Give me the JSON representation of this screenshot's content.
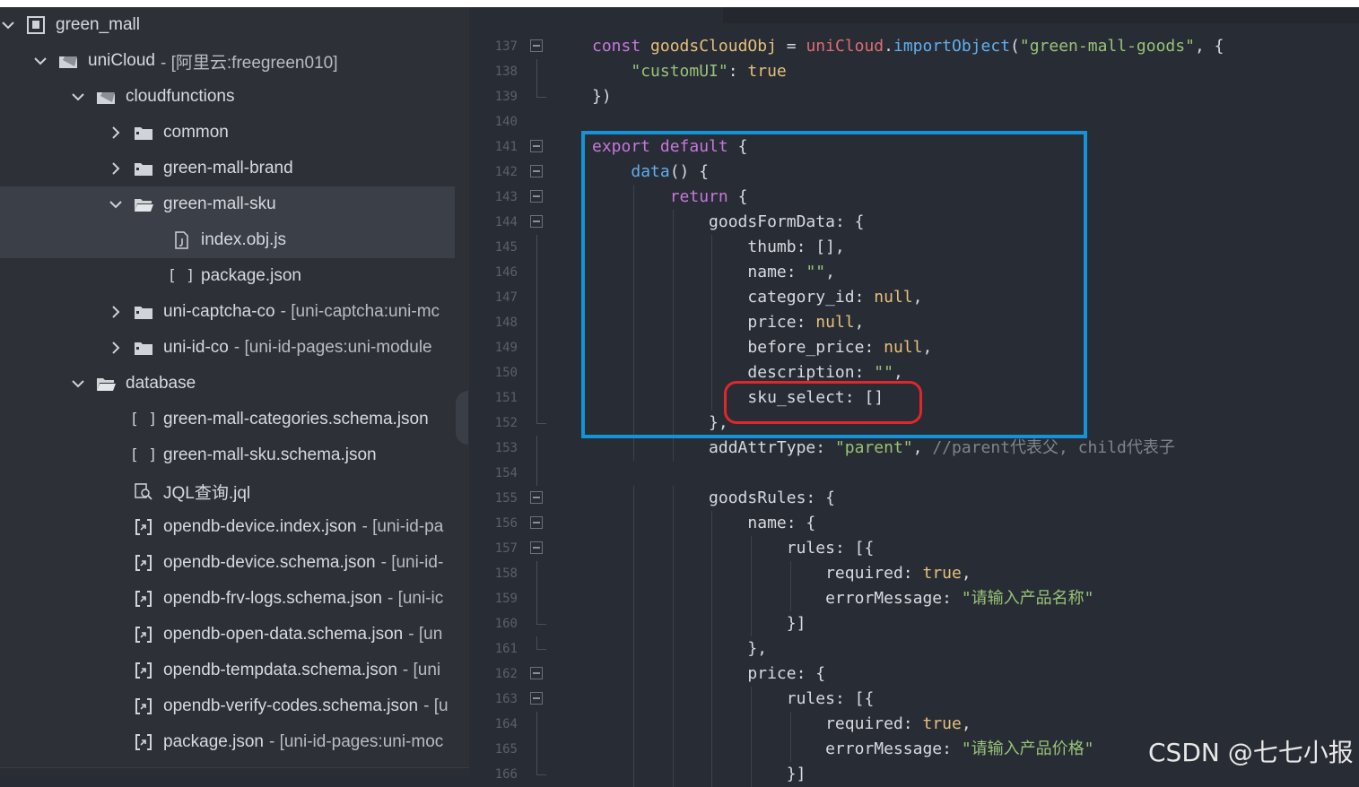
{
  "explorer": {
    "items": [
      {
        "name": "green_mall",
        "meta": "",
        "icon": "project-icon",
        "arrow": "expanded",
        "indent": 0
      },
      {
        "name": "uniCloud",
        "meta": "- [阿里云:freegreen010]",
        "icon": "cloud-folder-icon",
        "arrow": "expanded",
        "indent": 1
      },
      {
        "name": "cloudfunctions",
        "meta": "",
        "icon": "cloud-folder-icon",
        "arrow": "expanded",
        "indent": 2
      },
      {
        "name": "common",
        "meta": "",
        "icon": "folder-icon",
        "arrow": "collapsed",
        "indent": 3
      },
      {
        "name": "green-mall-brand",
        "meta": "",
        "icon": "folder-icon",
        "arrow": "collapsed",
        "indent": 3
      },
      {
        "name": "green-mall-sku",
        "meta": "",
        "icon": "folder-open-icon",
        "arrow": "expanded",
        "indent": 3,
        "selected": true,
        "right_icon": "folder-icon"
      },
      {
        "name": "index.obj.js",
        "meta": "",
        "icon": "js-file-icon",
        "arrow": "none",
        "indent": 4,
        "selected": true
      },
      {
        "name": "package.json",
        "meta": "",
        "icon": "json-file-icon",
        "arrow": "none",
        "indent": 4
      },
      {
        "name": "uni-captcha-co",
        "meta": "- [uni-captcha:uni-mc",
        "icon": "folder-icon",
        "arrow": "collapsed",
        "indent": 3
      },
      {
        "name": "uni-id-co",
        "meta": "- [uni-id-pages:uni-module",
        "icon": "folder-icon",
        "arrow": "collapsed",
        "indent": 3
      },
      {
        "name": "database",
        "meta": "",
        "icon": "folder-open-icon",
        "arrow": "expanded",
        "indent": 2
      },
      {
        "name": "green-mall-categories.schema.json",
        "meta": "",
        "icon": "json-file-icon",
        "arrow": "none",
        "indent": 3
      },
      {
        "name": "green-mall-sku.schema.json",
        "meta": "",
        "icon": "json-file-icon",
        "arrow": "none",
        "indent": 3
      },
      {
        "name": "JQL查询.jql",
        "meta": "",
        "icon": "jql-file-icon",
        "arrow": "none",
        "indent": 3
      },
      {
        "name": "opendb-device.index.json",
        "meta": "- [uni-id-pa",
        "icon": "linked-json-icon",
        "arrow": "none",
        "indent": 3
      },
      {
        "name": "opendb-device.schema.json",
        "meta": "- [uni-id-",
        "icon": "linked-json-icon",
        "arrow": "none",
        "indent": 3
      },
      {
        "name": "opendb-frv-logs.schema.json",
        "meta": "- [uni-ic",
        "icon": "linked-json-icon",
        "arrow": "none",
        "indent": 3
      },
      {
        "name": "opendb-open-data.schema.json",
        "meta": "- [un",
        "icon": "linked-json-icon",
        "arrow": "none",
        "indent": 3
      },
      {
        "name": "opendb-tempdata.schema.json",
        "meta": "- [uni",
        "icon": "linked-json-icon",
        "arrow": "none",
        "indent": 3
      },
      {
        "name": "opendb-verify-codes.schema.json",
        "meta": "- [u",
        "icon": "linked-json-icon",
        "arrow": "none",
        "indent": 3
      },
      {
        "name": "package.json",
        "meta": "- [uni-id-pages:uni-moc",
        "icon": "linked-json-icon",
        "arrow": "none",
        "indent": 3
      }
    ]
  },
  "editor": {
    "lines": [
      {
        "n": "137",
        "fold": "open",
        "tokens": [
          [
            "kw",
            "const "
          ],
          [
            "var",
            "goodsCloudObj"
          ],
          [
            "plain",
            " = "
          ],
          [
            "cls",
            "uniCloud"
          ],
          [
            "plain",
            "."
          ],
          [
            "fn",
            "importObject"
          ],
          [
            "plain",
            "("
          ],
          [
            "str",
            "\"green-mall-goods\""
          ],
          [
            "plain",
            ", {"
          ]
        ]
      },
      {
        "n": "138",
        "fold": "line",
        "tokens": [
          [
            "plain",
            "    "
          ],
          [
            "str",
            "\"customUI\""
          ],
          [
            "plain",
            ": "
          ],
          [
            "bool",
            "true"
          ]
        ]
      },
      {
        "n": "139",
        "fold": "end",
        "tokens": [
          [
            "plain",
            "})"
          ]
        ]
      },
      {
        "n": "140",
        "fold": "",
        "tokens": []
      },
      {
        "n": "141",
        "fold": "open",
        "tokens": [
          [
            "kw",
            "export default "
          ],
          [
            "plain",
            "{"
          ]
        ]
      },
      {
        "n": "142",
        "fold": "open",
        "tokens": [
          [
            "plain",
            "    "
          ],
          [
            "fn",
            "data"
          ],
          [
            "plain",
            "() {"
          ]
        ]
      },
      {
        "n": "143",
        "fold": "open",
        "tokens": [
          [
            "plain",
            "        "
          ],
          [
            "kw",
            "return "
          ],
          [
            "plain",
            "{"
          ]
        ]
      },
      {
        "n": "144",
        "fold": "open",
        "tokens": [
          [
            "plain",
            "            "
          ],
          [
            "prop",
            "goodsFormData"
          ],
          [
            "plain",
            ": {"
          ]
        ]
      },
      {
        "n": "145",
        "fold": "line",
        "tokens": [
          [
            "plain",
            "                "
          ],
          [
            "prop",
            "thumb"
          ],
          [
            "plain",
            ": [],"
          ]
        ]
      },
      {
        "n": "146",
        "fold": "line",
        "tokens": [
          [
            "plain",
            "                "
          ],
          [
            "prop",
            "name"
          ],
          [
            "plain",
            ": "
          ],
          [
            "str",
            "\"\""
          ],
          [
            "plain",
            ","
          ]
        ]
      },
      {
        "n": "147",
        "fold": "line",
        "tokens": [
          [
            "plain",
            "                "
          ],
          [
            "prop",
            "category_id"
          ],
          [
            "plain",
            ": "
          ],
          [
            "bool",
            "null"
          ],
          [
            "plain",
            ","
          ]
        ]
      },
      {
        "n": "148",
        "fold": "line",
        "tokens": [
          [
            "plain",
            "                "
          ],
          [
            "prop",
            "price"
          ],
          [
            "plain",
            ": "
          ],
          [
            "bool",
            "null"
          ],
          [
            "plain",
            ","
          ]
        ]
      },
      {
        "n": "149",
        "fold": "line",
        "tokens": [
          [
            "plain",
            "                "
          ],
          [
            "prop",
            "before_price"
          ],
          [
            "plain",
            ": "
          ],
          [
            "bool",
            "null"
          ],
          [
            "plain",
            ","
          ]
        ]
      },
      {
        "n": "150",
        "fold": "line",
        "tokens": [
          [
            "plain",
            "                "
          ],
          [
            "prop",
            "description"
          ],
          [
            "plain",
            ": "
          ],
          [
            "str",
            "\"\""
          ],
          [
            "plain",
            ","
          ]
        ]
      },
      {
        "n": "151",
        "fold": "line",
        "tokens": [
          [
            "plain",
            "                "
          ],
          [
            "prop",
            "sku_select"
          ],
          [
            "plain",
            ": []"
          ]
        ]
      },
      {
        "n": "152",
        "fold": "end",
        "tokens": [
          [
            "plain",
            "            },"
          ]
        ]
      },
      {
        "n": "153",
        "fold": "line",
        "tokens": [
          [
            "plain",
            "            "
          ],
          [
            "prop",
            "addAttrType"
          ],
          [
            "plain",
            ": "
          ],
          [
            "str",
            "\"parent\""
          ],
          [
            "plain",
            ", "
          ],
          [
            "cmt",
            "//parent代表父, child代表子"
          ]
        ]
      },
      {
        "n": "154",
        "fold": "line",
        "tokens": []
      },
      {
        "n": "155",
        "fold": "open",
        "tokens": [
          [
            "plain",
            "            "
          ],
          [
            "prop",
            "goodsRules"
          ],
          [
            "plain",
            ": {"
          ]
        ]
      },
      {
        "n": "156",
        "fold": "open",
        "tokens": [
          [
            "plain",
            "                "
          ],
          [
            "prop",
            "name"
          ],
          [
            "plain",
            ": {"
          ]
        ]
      },
      {
        "n": "157",
        "fold": "open",
        "tokens": [
          [
            "plain",
            "                    "
          ],
          [
            "prop",
            "rules"
          ],
          [
            "plain",
            ": [{"
          ]
        ]
      },
      {
        "n": "158",
        "fold": "line",
        "tokens": [
          [
            "plain",
            "                        "
          ],
          [
            "prop",
            "required"
          ],
          [
            "plain",
            ": "
          ],
          [
            "bool",
            "true"
          ],
          [
            "plain",
            ","
          ]
        ]
      },
      {
        "n": "159",
        "fold": "line",
        "tokens": [
          [
            "plain",
            "                        "
          ],
          [
            "prop",
            "errorMessage"
          ],
          [
            "plain",
            ": "
          ],
          [
            "str",
            "\"请输入产品名称\""
          ]
        ]
      },
      {
        "n": "160",
        "fold": "end",
        "tokens": [
          [
            "plain",
            "                    }]"
          ]
        ]
      },
      {
        "n": "161",
        "fold": "end",
        "tokens": [
          [
            "plain",
            "                },"
          ]
        ]
      },
      {
        "n": "162",
        "fold": "open",
        "tokens": [
          [
            "plain",
            "                "
          ],
          [
            "prop",
            "price"
          ],
          [
            "plain",
            ": {"
          ]
        ]
      },
      {
        "n": "163",
        "fold": "open",
        "tokens": [
          [
            "plain",
            "                    "
          ],
          [
            "prop",
            "rules"
          ],
          [
            "plain",
            ": [{"
          ]
        ]
      },
      {
        "n": "164",
        "fold": "line",
        "tokens": [
          [
            "plain",
            "                        "
          ],
          [
            "prop",
            "required"
          ],
          [
            "plain",
            ": "
          ],
          [
            "bool",
            "true"
          ],
          [
            "plain",
            ","
          ]
        ]
      },
      {
        "n": "165",
        "fold": "line",
        "tokens": [
          [
            "plain",
            "                        "
          ],
          [
            "prop",
            "errorMessage"
          ],
          [
            "plain",
            ": "
          ],
          [
            "str",
            "\"请输入产品价格\""
          ]
        ]
      },
      {
        "n": "166",
        "fold": "end",
        "tokens": [
          [
            "plain",
            "                    }]"
          ]
        ]
      }
    ]
  },
  "watermark": "CSDN @七七小报",
  "colors": {
    "highlight_box": "#1493d8",
    "annotation_circle": "#e2262b"
  }
}
